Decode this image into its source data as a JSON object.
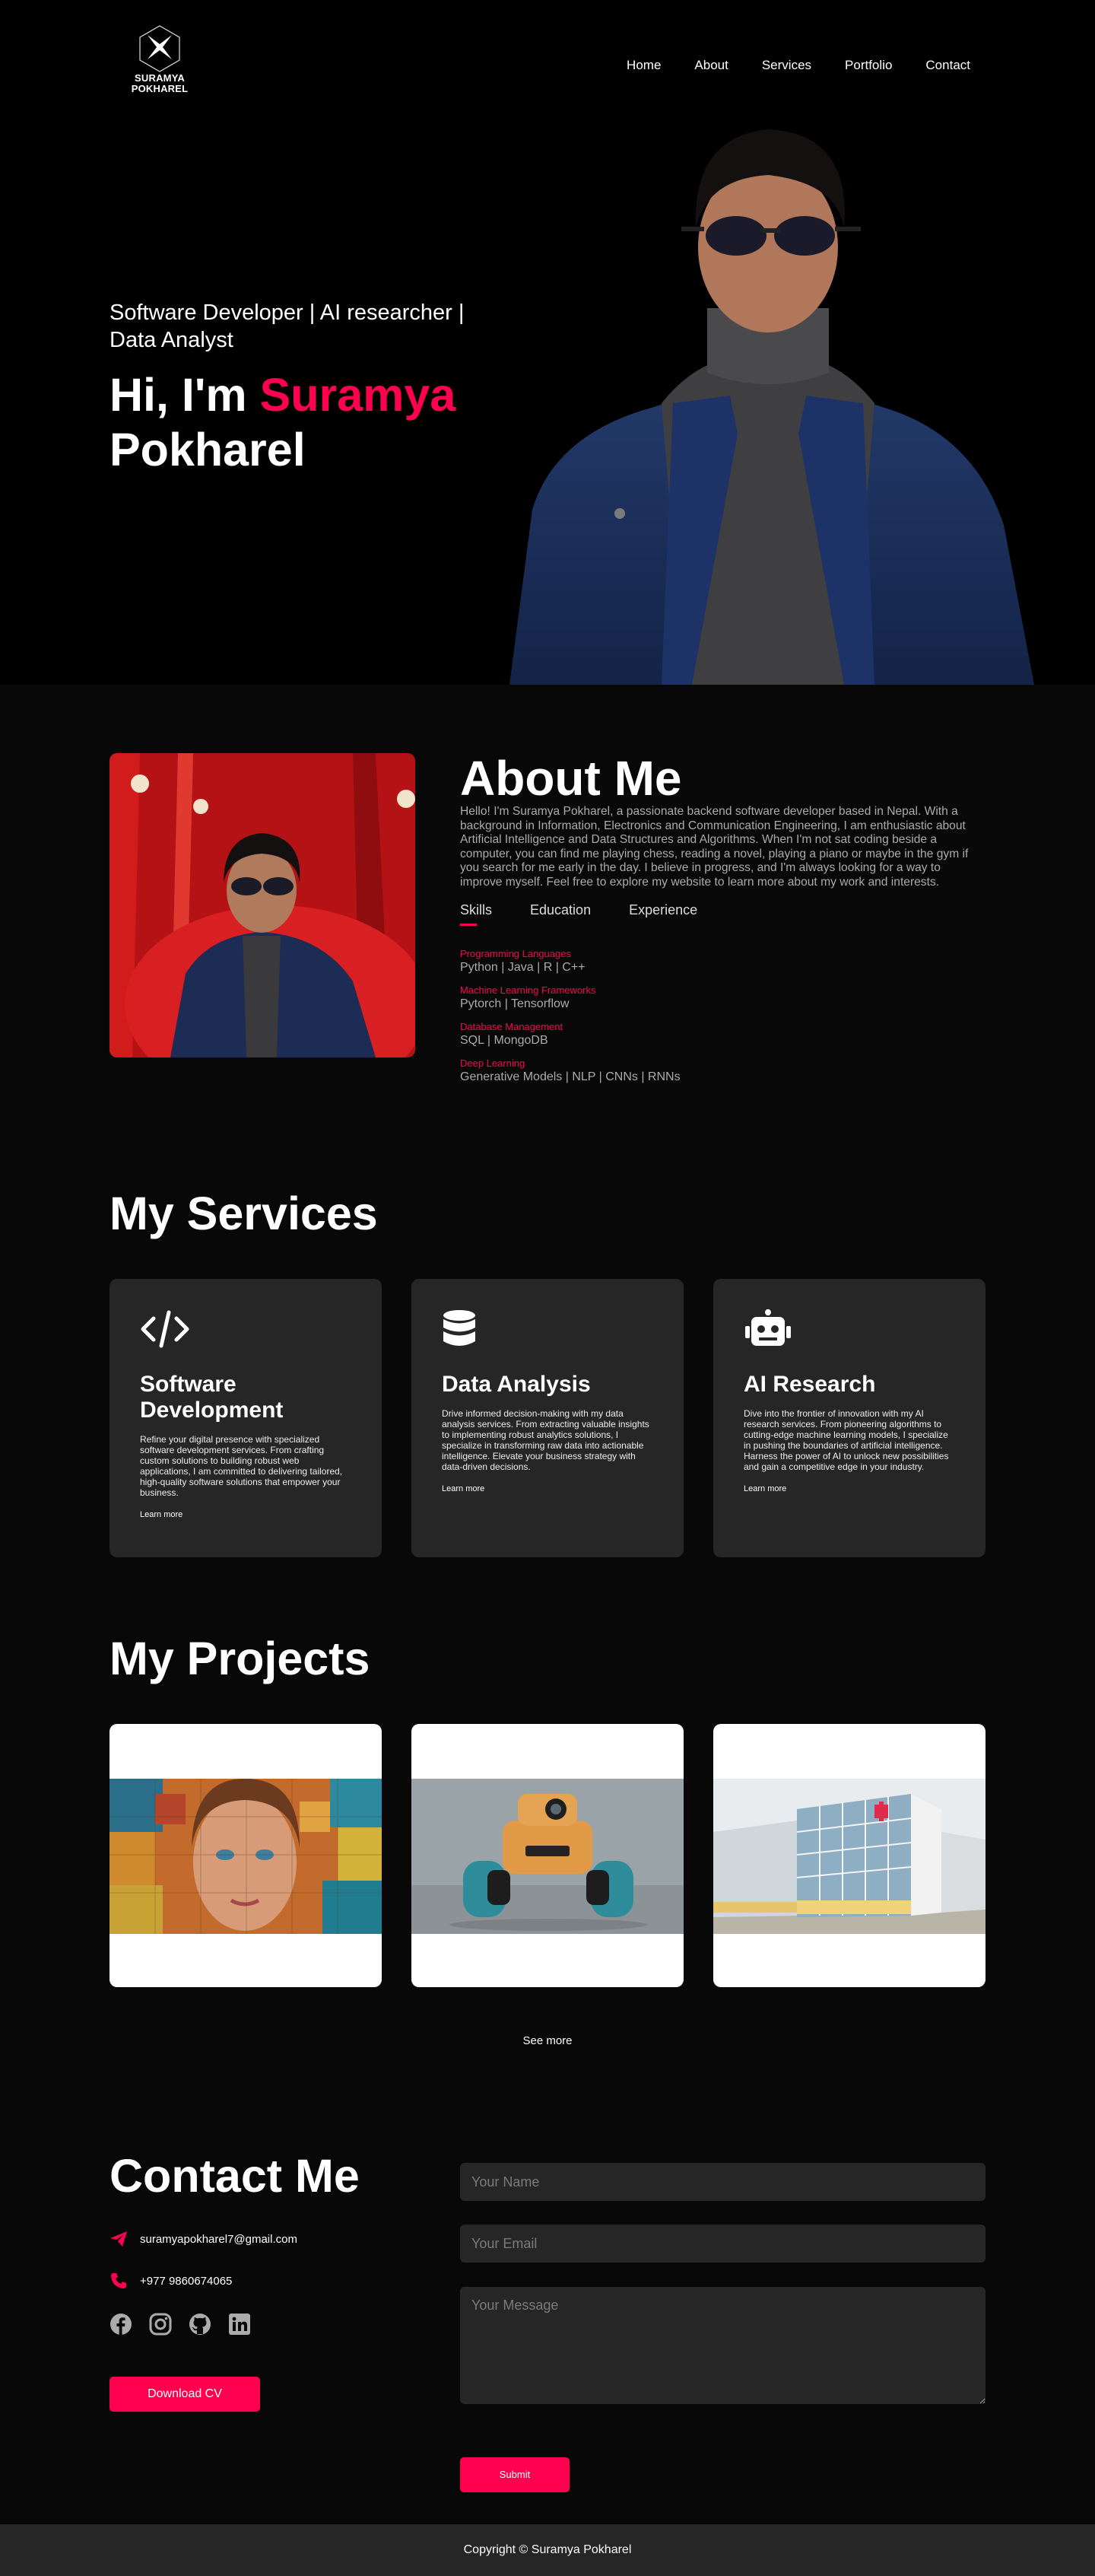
{
  "brand": {
    "logo_line1": "SURAMYA",
    "logo_line2": "POKHAREL"
  },
  "nav": {
    "items": [
      "Home",
      "About",
      "Services",
      "Portfolio",
      "Contact"
    ]
  },
  "hero": {
    "subtitle": "Software Developer | AI researcher | Data Analyst",
    "greeting": "Hi, I'm ",
    "name_highlight": "Suramya",
    "surname": "Pokharel"
  },
  "about": {
    "title": "About Me",
    "text": "Hello! I'm Suramya Pokharel, a passionate backend software developer based in Nepal. With a background in Information, Electronics and Communication Engineering, I am enthusiastic about Artificial Intelligence and Data Structures and Algorithms. When I'm not sat coding beside a computer, you can find me playing chess, reading a novel, playing a piano or maybe in the gym if you search for me early in the day. I believe in progress, and I'm always looking for a way to improve myself. Feel free to explore my website to learn more about my work and interests.",
    "tabs": [
      "Skills",
      "Education",
      "Experience"
    ],
    "skills": [
      {
        "category": "Programming Languages",
        "value": "Python | Java | R | C++"
      },
      {
        "category": "Machine Learning Frameworks",
        "value": "Pytorch | Tensorflow"
      },
      {
        "category": "Database Management",
        "value": "SQL | MongoDB"
      },
      {
        "category": "Deep Learning",
        "value": "Generative Models | NLP | CNNs | RNNs"
      }
    ]
  },
  "services": {
    "title": "My Services",
    "items": [
      {
        "icon": "code-icon",
        "name": "Software Development",
        "desc": "Refine your digital presence with specialized software development services. From crafting custom solutions to building robust web applications, I am committed to delivering tailored, high-quality software solutions that empower your business.",
        "link": "Learn more"
      },
      {
        "icon": "database-icon",
        "name": "Data Analysis",
        "desc": "Drive informed decision-making with my data analysis services. From extracting valuable insights to implementing robust analytics solutions, I specialize in transforming raw data into actionable intelligence. Elevate your business strategy with data-driven decisions.",
        "link": "Learn more"
      },
      {
        "icon": "robot-icon",
        "name": "AI Research",
        "desc": "Dive into the frontier of innovation with my AI research services. From pioneering algorithms to cutting-edge machine learning models, I specialize in pushing the boundaries of artificial intelligence. Harness the power of AI to unlock new possibilities and gain a competitive edge in your industry.",
        "link": "Learn more"
      }
    ]
  },
  "projects": {
    "title": "My Projects",
    "see_more": "See more"
  },
  "contact": {
    "title": "Contact Me",
    "email": "suramyapokharel7@gmail.com",
    "phone": "+977 9860674065",
    "download_cv": "Download CV",
    "name_placeholder": "Your Name",
    "email_placeholder": "Your Email",
    "message_placeholder": "Your Message",
    "submit": "Submit"
  },
  "footer": {
    "text": "Copyright © Suramya Pokharel"
  },
  "colors": {
    "accent": "#ff004f",
    "background": "#080808",
    "card": "#262626"
  }
}
